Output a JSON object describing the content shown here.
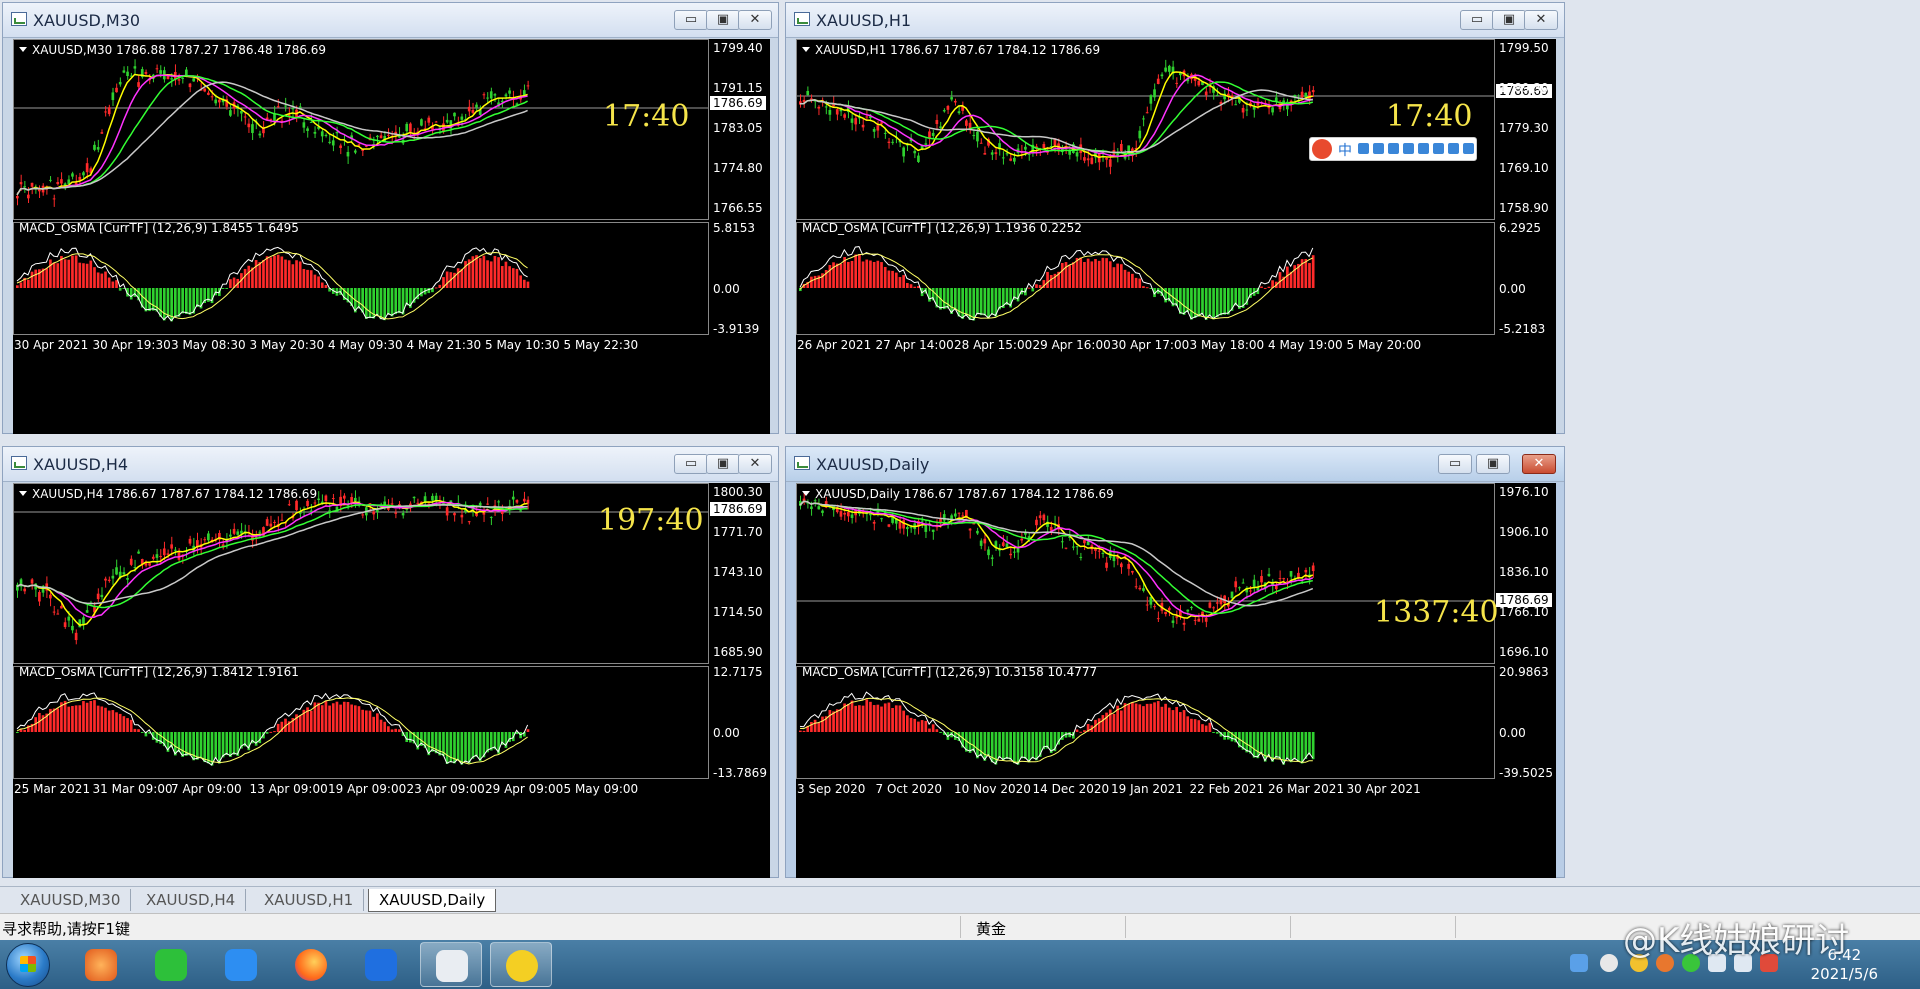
{
  "windows": [
    {
      "title": "XAUUSD,M30",
      "symbol_line": "XAUUSD,M30  1786.88 1787.27 1786.48 1786.69",
      "macd_line": "MACD_OsMA [CurrTF] (12,26,9) 1.8455 1.6495",
      "clock": "17:40",
      "price_box": "1786.69",
      "price_ticks": [
        "1799.40",
        "1791.15",
        "1783.05",
        "1774.80",
        "1766.55"
      ],
      "macd_ticks": [
        "5.8153",
        "0.00",
        "-3.9139"
      ],
      "dates": [
        "30 Apr 2021",
        "30 Apr 19:30",
        "3 May 08:30",
        "3 May 20:30",
        "4 May 09:30",
        "4 May 21:30",
        "5 May 10:30",
        "5 May 22:30"
      ]
    },
    {
      "title": "XAUUSD,H1",
      "symbol_line": "XAUUSD,H1  1786.67 1787.67 1784.12 1786.69",
      "macd_line": "MACD_OsMA [CurrTF] (12,26,9) 1.1936 0.2252",
      "clock": "17:40",
      "price_box": "1786.69",
      "price_ticks": [
        "1799.50",
        "1789.30",
        "1779.30",
        "1769.10",
        "1758.90"
      ],
      "macd_ticks": [
        "6.2925",
        "0.00",
        "-5.2183"
      ],
      "dates": [
        "26 Apr 2021",
        "27 Apr 14:00",
        "28 Apr 15:00",
        "29 Apr 16:00",
        "30 Apr 17:00",
        "3 May 18:00",
        "4 May 19:00",
        "5 May 20:00"
      ]
    },
    {
      "title": "XAUUSD,H4",
      "symbol_line": "XAUUSD,H4  1786.67 1787.67 1784.12 1786.69",
      "macd_line": "MACD_OsMA [CurrTF] (12,26,9) 1.8412 1.9161",
      "clock": "197:40",
      "price_box": "1786.69",
      "price_ticks": [
        "1800.30",
        "1771.70",
        "1743.10",
        "1714.50",
        "1685.90"
      ],
      "macd_ticks": [
        "12.7175",
        "0.00",
        "-13.7869"
      ],
      "dates": [
        "25 Mar 2021",
        "31 Mar 09:00",
        "7 Apr 09:00",
        "13 Apr 09:00",
        "19 Apr 09:00",
        "23 Apr 09:00",
        "29 Apr 09:00",
        "5 May 09:00"
      ]
    },
    {
      "title": "XAUUSD,Daily",
      "symbol_line": "XAUUSD,Daily  1786.67 1787.67 1784.12 1786.69",
      "macd_line": "MACD_OsMA [CurrTF] (12,26,9) 10.3158 10.4777",
      "clock": "1337:40",
      "price_box": "1786.69",
      "price_ticks": [
        "1976.10",
        "1906.10",
        "1836.10",
        "1766.10",
        "1696.10"
      ],
      "macd_ticks": [
        "20.9863",
        "0.00",
        "-39.5025"
      ],
      "dates": [
        "3 Sep 2020",
        "7 Oct 2020",
        "10 Nov 2020",
        "14 Dec 2020",
        "19 Jan 2021",
        "22 Feb 2021",
        "26 Mar 2021",
        "30 Apr 2021"
      ]
    }
  ],
  "window_buttons": {
    "minimize": "▭",
    "maximize": "▣",
    "close": "✕"
  },
  "tabs": [
    "XAUUSD,M30",
    "XAUUSD,H4",
    "XAUUSD,H1",
    "XAUUSD,Daily"
  ],
  "status": {
    "help": "寻求帮助,请按F1键",
    "symbol": "黄金"
  },
  "taskbar": {
    "time": "6:42",
    "date": "2021/5/6"
  },
  "watermark": "@K线姑娘研讨",
  "colors": {
    "bull": "#ff2a2a",
    "bear": "#2fd12f",
    "ma_fast": "#ffff00",
    "ma_mid": "#ff33ff",
    "ma_slow": "#33ff33",
    "ma_long": "#c8c8c8",
    "clock": "#f5e44a"
  },
  "toolbar_ime": {
    "label": "中"
  }
}
